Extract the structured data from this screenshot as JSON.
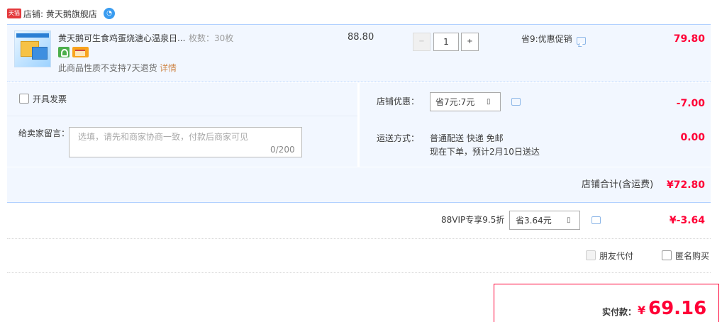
{
  "shop": {
    "badge": "天猫",
    "name": "店铺: 黄天鹅旗舰店",
    "chat_icon": "wangwang-chat-icon"
  },
  "item": {
    "title": "黄天鹅可生食鸡蛋烧溏心温泉日...",
    "sku": "枚数：30枚",
    "no_return": "此商品性质不支持7天退货",
    "detail_link": "详情",
    "unit_price": "88.80",
    "quantity": "1",
    "minus": "−",
    "plus": "+",
    "promo": "省9:优惠促销",
    "total": "79.80"
  },
  "invoice": {
    "label": "开具发票"
  },
  "message": {
    "label": "给卖家留言：",
    "placeholder": "选填，请先和商家协商一致，付款后商家可见",
    "counter": "0/200"
  },
  "shop_discount": {
    "label": "店铺优惠：",
    "selected": "省7元:7元",
    "amount": "-7.00"
  },
  "shipping": {
    "label": "运送方式：",
    "method": "普通配送 快递 免邮",
    "eta": "现在下单，预计2月10日送达",
    "amount": "0.00"
  },
  "subtotal": {
    "label": "店铺合计(含运费)",
    "amount": "¥72.80"
  },
  "vip": {
    "label": "88VIP专享9.5折",
    "selected": "省3.64元",
    "amount": "¥-3.64"
  },
  "options": {
    "friend_pay": "朋友代付",
    "anonymous": "匿名购买"
  },
  "payment": {
    "label": "实付款：",
    "currency": "¥",
    "amount": "69.16"
  },
  "colors": {
    "accent": "#ff0036",
    "panel": "#f2f7ff",
    "border": "#b2d1ff",
    "link": "#d08a4e"
  }
}
